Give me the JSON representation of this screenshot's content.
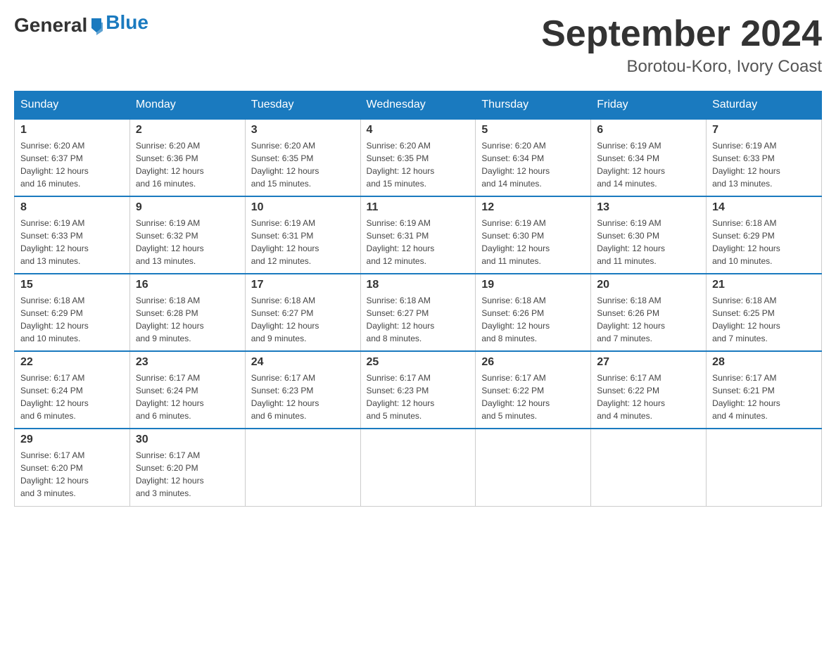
{
  "header": {
    "logo_general": "General",
    "logo_blue": "Blue",
    "month_title": "September 2024",
    "location": "Borotou-Koro, Ivory Coast"
  },
  "weekdays": [
    "Sunday",
    "Monday",
    "Tuesday",
    "Wednesday",
    "Thursday",
    "Friday",
    "Saturday"
  ],
  "weeks": [
    [
      {
        "day": "1",
        "sunrise": "6:20 AM",
        "sunset": "6:37 PM",
        "daylight": "12 hours and 16 minutes."
      },
      {
        "day": "2",
        "sunrise": "6:20 AM",
        "sunset": "6:36 PM",
        "daylight": "12 hours and 16 minutes."
      },
      {
        "day": "3",
        "sunrise": "6:20 AM",
        "sunset": "6:35 PM",
        "daylight": "12 hours and 15 minutes."
      },
      {
        "day": "4",
        "sunrise": "6:20 AM",
        "sunset": "6:35 PM",
        "daylight": "12 hours and 15 minutes."
      },
      {
        "day": "5",
        "sunrise": "6:20 AM",
        "sunset": "6:34 PM",
        "daylight": "12 hours and 14 minutes."
      },
      {
        "day": "6",
        "sunrise": "6:19 AM",
        "sunset": "6:34 PM",
        "daylight": "12 hours and 14 minutes."
      },
      {
        "day": "7",
        "sunrise": "6:19 AM",
        "sunset": "6:33 PM",
        "daylight": "12 hours and 13 minutes."
      }
    ],
    [
      {
        "day": "8",
        "sunrise": "6:19 AM",
        "sunset": "6:33 PM",
        "daylight": "12 hours and 13 minutes."
      },
      {
        "day": "9",
        "sunrise": "6:19 AM",
        "sunset": "6:32 PM",
        "daylight": "12 hours and 13 minutes."
      },
      {
        "day": "10",
        "sunrise": "6:19 AM",
        "sunset": "6:31 PM",
        "daylight": "12 hours and 12 minutes."
      },
      {
        "day": "11",
        "sunrise": "6:19 AM",
        "sunset": "6:31 PM",
        "daylight": "12 hours and 12 minutes."
      },
      {
        "day": "12",
        "sunrise": "6:19 AM",
        "sunset": "6:30 PM",
        "daylight": "12 hours and 11 minutes."
      },
      {
        "day": "13",
        "sunrise": "6:19 AM",
        "sunset": "6:30 PM",
        "daylight": "12 hours and 11 minutes."
      },
      {
        "day": "14",
        "sunrise": "6:18 AM",
        "sunset": "6:29 PM",
        "daylight": "12 hours and 10 minutes."
      }
    ],
    [
      {
        "day": "15",
        "sunrise": "6:18 AM",
        "sunset": "6:29 PM",
        "daylight": "12 hours and 10 minutes."
      },
      {
        "day": "16",
        "sunrise": "6:18 AM",
        "sunset": "6:28 PM",
        "daylight": "12 hours and 9 minutes."
      },
      {
        "day": "17",
        "sunrise": "6:18 AM",
        "sunset": "6:27 PM",
        "daylight": "12 hours and 9 minutes."
      },
      {
        "day": "18",
        "sunrise": "6:18 AM",
        "sunset": "6:27 PM",
        "daylight": "12 hours and 8 minutes."
      },
      {
        "day": "19",
        "sunrise": "6:18 AM",
        "sunset": "6:26 PM",
        "daylight": "12 hours and 8 minutes."
      },
      {
        "day": "20",
        "sunrise": "6:18 AM",
        "sunset": "6:26 PM",
        "daylight": "12 hours and 7 minutes."
      },
      {
        "day": "21",
        "sunrise": "6:18 AM",
        "sunset": "6:25 PM",
        "daylight": "12 hours and 7 minutes."
      }
    ],
    [
      {
        "day": "22",
        "sunrise": "6:17 AM",
        "sunset": "6:24 PM",
        "daylight": "12 hours and 6 minutes."
      },
      {
        "day": "23",
        "sunrise": "6:17 AM",
        "sunset": "6:24 PM",
        "daylight": "12 hours and 6 minutes."
      },
      {
        "day": "24",
        "sunrise": "6:17 AM",
        "sunset": "6:23 PM",
        "daylight": "12 hours and 6 minutes."
      },
      {
        "day": "25",
        "sunrise": "6:17 AM",
        "sunset": "6:23 PM",
        "daylight": "12 hours and 5 minutes."
      },
      {
        "day": "26",
        "sunrise": "6:17 AM",
        "sunset": "6:22 PM",
        "daylight": "12 hours and 5 minutes."
      },
      {
        "day": "27",
        "sunrise": "6:17 AM",
        "sunset": "6:22 PM",
        "daylight": "12 hours and 4 minutes."
      },
      {
        "day": "28",
        "sunrise": "6:17 AM",
        "sunset": "6:21 PM",
        "daylight": "12 hours and 4 minutes."
      }
    ],
    [
      {
        "day": "29",
        "sunrise": "6:17 AM",
        "sunset": "6:20 PM",
        "daylight": "12 hours and 3 minutes."
      },
      {
        "day": "30",
        "sunrise": "6:17 AM",
        "sunset": "6:20 PM",
        "daylight": "12 hours and 3 minutes."
      },
      null,
      null,
      null,
      null,
      null
    ]
  ]
}
